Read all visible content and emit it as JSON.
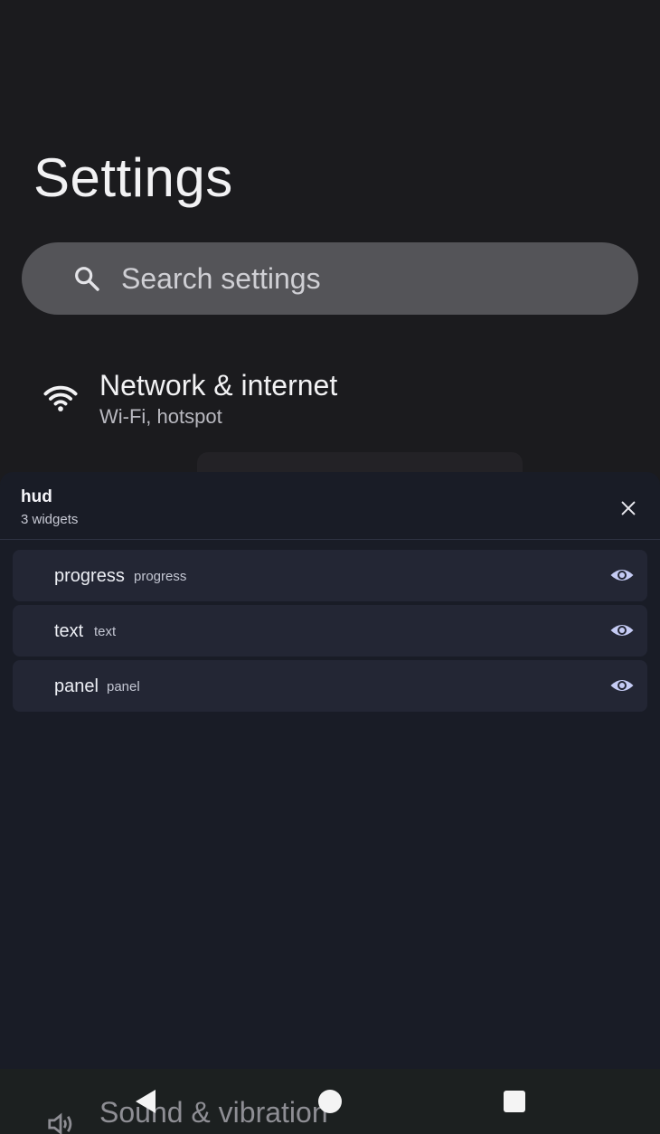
{
  "page": {
    "title": "Settings"
  },
  "search": {
    "placeholder": "Search settings",
    "icon": "search-icon"
  },
  "settings_items": [
    {
      "title": "Network & internet",
      "subtitle": "Wi-Fi, hotspot",
      "icon": "wifi-icon"
    },
    {
      "title": "Sound & vibration",
      "icon": "volume-icon"
    }
  ],
  "hud": {
    "title": "hud",
    "count_label": "3 widgets",
    "widgets": [
      {
        "name": "progress",
        "type": "progress",
        "visible": true
      },
      {
        "name": "text",
        "type": "text",
        "visible": true
      },
      {
        "name": "panel",
        "type": "panel",
        "visible": true
      }
    ]
  },
  "navigation": {
    "back": "back-icon",
    "home": "home-icon",
    "recents": "recents-icon"
  },
  "colors": {
    "background": "#1b1b1e",
    "search_bar": "#545458",
    "hud_panel": "#191c26",
    "widget_row": "#232634",
    "eye_accent": "#c5cbf4"
  }
}
